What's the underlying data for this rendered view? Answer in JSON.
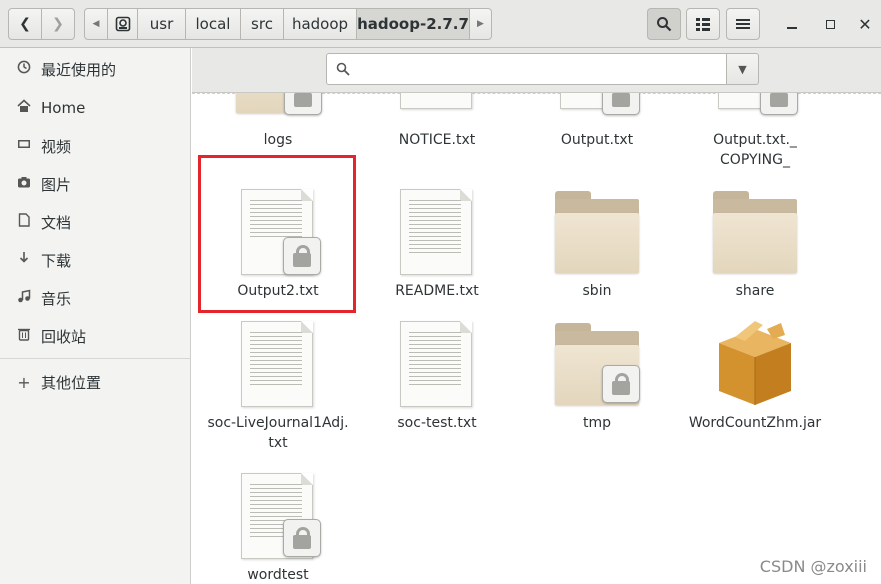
{
  "header": {
    "breadcrumbs": [
      "usr",
      "local",
      "src",
      "hadoop",
      "hadoop-2.7.7"
    ],
    "active_crumb": "hadoop-2.7.7"
  },
  "sidebar": {
    "items": [
      {
        "label": "最近使用的",
        "icon": "clock-icon"
      },
      {
        "label": "Home",
        "icon": "home-icon"
      },
      {
        "label": "视频",
        "icon": "video-icon"
      },
      {
        "label": "图片",
        "icon": "camera-icon"
      },
      {
        "label": "文档",
        "icon": "document-icon"
      },
      {
        "label": "下载",
        "icon": "download-icon"
      },
      {
        "label": "音乐",
        "icon": "music-icon"
      },
      {
        "label": "回收站",
        "icon": "trash-icon"
      },
      {
        "label": "其他位置",
        "icon": "plus-icon"
      }
    ]
  },
  "search": {
    "placeholder": ""
  },
  "files": [
    {
      "name": "logs",
      "kind": "folder",
      "locked": true
    },
    {
      "name": "NOTICE.txt",
      "kind": "text",
      "locked": false
    },
    {
      "name": "Output.txt",
      "kind": "text",
      "locked": true
    },
    {
      "name": "Output.txt._",
      "name2": "COPYING_",
      "kind": "text",
      "locked": true
    },
    {
      "name": "Output2.txt",
      "kind": "text",
      "locked": true,
      "highlighted": true
    },
    {
      "name": "README.txt",
      "kind": "text",
      "locked": false
    },
    {
      "name": "sbin",
      "kind": "folder",
      "locked": false
    },
    {
      "name": "share",
      "kind": "folder",
      "locked": false
    },
    {
      "name": "soc-LiveJournal1Adj.",
      "name2": "txt",
      "kind": "text",
      "locked": false
    },
    {
      "name": "soc-test.txt",
      "kind": "text",
      "locked": false
    },
    {
      "name": "tmp",
      "kind": "folder",
      "locked": true
    },
    {
      "name": "WordCountZhm.jar",
      "kind": "jar",
      "locked": false
    },
    {
      "name": "wordtest",
      "kind": "text",
      "locked": true
    }
  ],
  "watermark": "CSDN @zoxiii",
  "colors": {
    "highlight": "#e2262b",
    "sidebar_bg": "#f3f3f2",
    "header_bg": "#e8e8e7"
  }
}
